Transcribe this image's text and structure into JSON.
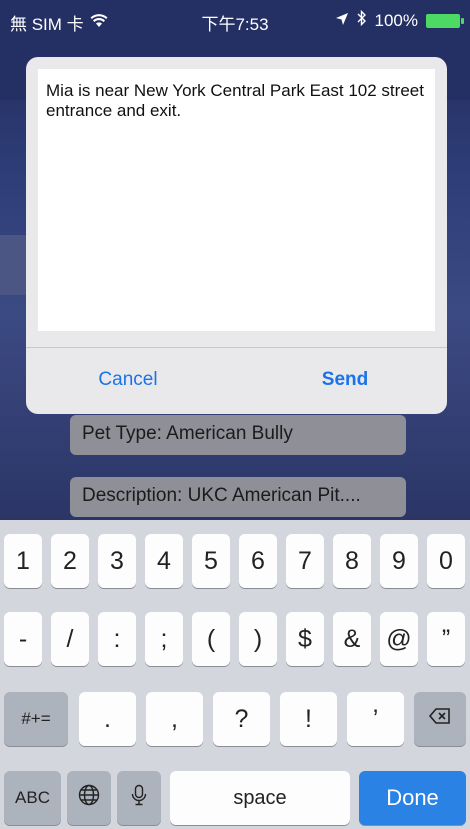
{
  "status_bar": {
    "carrier": "無 SIM 卡",
    "time": "下午7:53",
    "battery": "100%",
    "icons": [
      "wifi-icon",
      "location-icon",
      "bluetooth-icon",
      "battery-icon"
    ]
  },
  "background": {
    "field_pet_type": "Pet Type: American Bully",
    "field_description": "Description: UKC American Pit...."
  },
  "dialog": {
    "message_text": "Mia is near New York Central Park East 102 street entrance and exit.",
    "cancel_label": "Cancel",
    "send_label": "Send",
    "accent_color": "#1a73e8"
  },
  "keyboard": {
    "row1": [
      "1",
      "2",
      "3",
      "4",
      "5",
      "6",
      "7",
      "8",
      "9",
      "0"
    ],
    "row2": [
      "-",
      "/",
      ":",
      ";",
      "(",
      ")",
      "$",
      "&",
      "@",
      "”"
    ],
    "row3_mode": "#+=",
    "row3": [
      ".",
      ",",
      "?",
      "!",
      "’"
    ],
    "abc_label": "ABC",
    "space_label": "space",
    "done_label": "Done",
    "icons": [
      "globe-icon",
      "microphone-icon",
      "delete-icon"
    ]
  }
}
